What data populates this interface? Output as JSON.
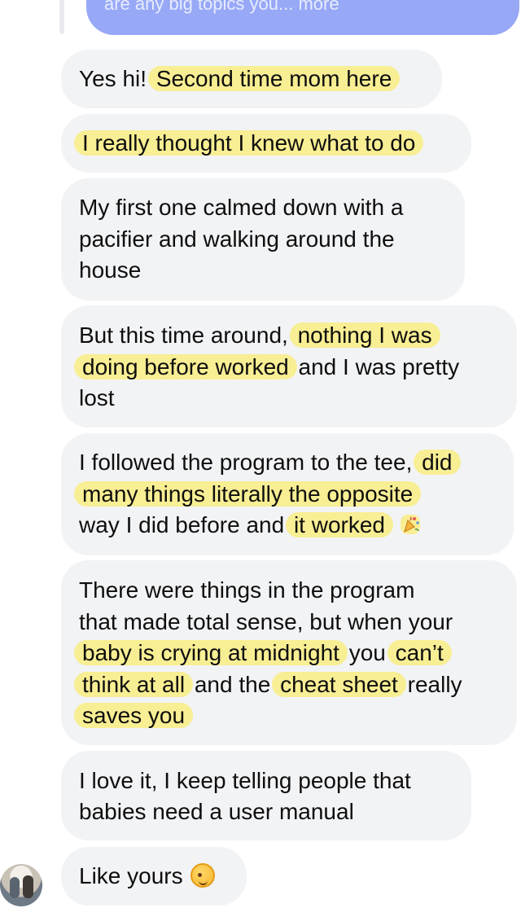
{
  "thread": {
    "sent_preview": "are any big topics you... more"
  },
  "messages": [
    {
      "lines": [
        [
          {
            "t": "Yes hi! ",
            "h": false
          },
          {
            "t": "Second time mom here",
            "h": true
          }
        ]
      ]
    },
    {
      "lines": [
        [
          {
            "t": "I really thought I knew what to do",
            "h": true
          }
        ]
      ]
    },
    {
      "lines": [
        [
          {
            "t": "My first one calmed down with a",
            "h": false
          }
        ],
        [
          {
            "t": "pacifier and walking around the",
            "h": false
          }
        ],
        [
          {
            "t": "house",
            "h": false
          }
        ]
      ]
    },
    {
      "lines": [
        [
          {
            "t": "But this time around, ",
            "h": false
          },
          {
            "t": "nothing I was",
            "h": true
          }
        ],
        [
          {
            "t": "doing before worked",
            "h": true
          },
          {
            "t": " and I was pretty",
            "h": false
          }
        ],
        [
          {
            "t": "lost",
            "h": false
          }
        ]
      ]
    },
    {
      "lines": [
        [
          {
            "t": "I followed the program to the tee, ",
            "h": false
          },
          {
            "t": "did",
            "h": true
          }
        ],
        [
          {
            "t": "many things literally the opposite",
            "h": true
          }
        ],
        [
          {
            "t": "way I did before and ",
            "h": false
          },
          {
            "t": "it worked",
            "h": true
          }
        ]
      ],
      "trailing_emoji": "party-popper-emoji"
    },
    {
      "lines": [
        [
          {
            "t": "There were things in the program",
            "h": false
          }
        ],
        [
          {
            "t": "that made total sense, but when your",
            "h": false
          }
        ],
        [
          {
            "t": "baby is crying at midnight",
            "h": true
          },
          {
            "t": " you ",
            "h": false
          },
          {
            "t": "can’t",
            "h": true
          }
        ],
        [
          {
            "t": "think at all",
            "h": true
          },
          {
            "t": " and the ",
            "h": false
          },
          {
            "t": "cheat sheet",
            "h": true
          },
          {
            "t": " really",
            "h": false
          }
        ],
        [
          {
            "t": "saves you",
            "h": true
          }
        ]
      ]
    },
    {
      "lines": [
        [
          {
            "t": "I love it, I keep telling people that",
            "h": false
          }
        ],
        [
          {
            "t": "babies need a user manual",
            "h": false
          }
        ]
      ]
    },
    {
      "lines": [
        [
          {
            "t": "Like yours ",
            "h": false
          }
        ]
      ],
      "trailing_emoji": "winking-face-emoji"
    }
  ],
  "colors": {
    "bubble": "#f2f3f5",
    "highlight": "#f8ee93",
    "sent": "#97a8f6"
  }
}
